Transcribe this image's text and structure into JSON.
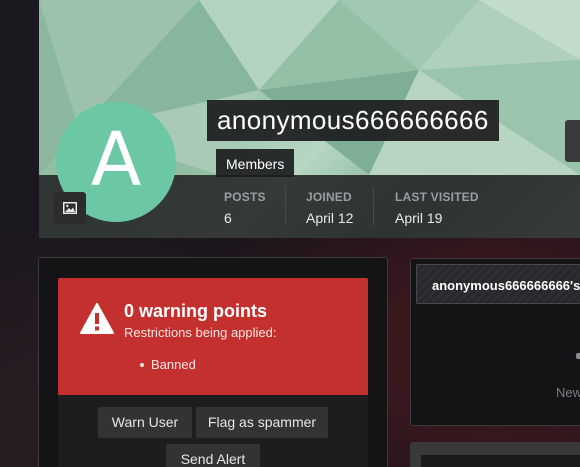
{
  "profile": {
    "avatar_letter": "A",
    "avatar_color": "#6cc7a5",
    "username": "anonymous666666666",
    "group": "Members",
    "photo_icon": "image-icon"
  },
  "stats": [
    {
      "label": "POSTS",
      "value": "6"
    },
    {
      "label": "JOINED",
      "value": "April 12"
    },
    {
      "label": "LAST VISITED",
      "value": "April 19"
    }
  ],
  "warnings": {
    "title": "0 warning points",
    "subtitle": "Restrictions being applied:",
    "restrictions": [
      "Banned"
    ],
    "accent_color": "#c4302e",
    "icon": "warning-icon"
  },
  "actions": {
    "warn_user": "Warn User",
    "flag_spammer": "Flag as spammer",
    "send_alert": "Send Alert"
  },
  "sidebar": {
    "panel_title": "anonymous666666666's",
    "new_text": "New"
  }
}
